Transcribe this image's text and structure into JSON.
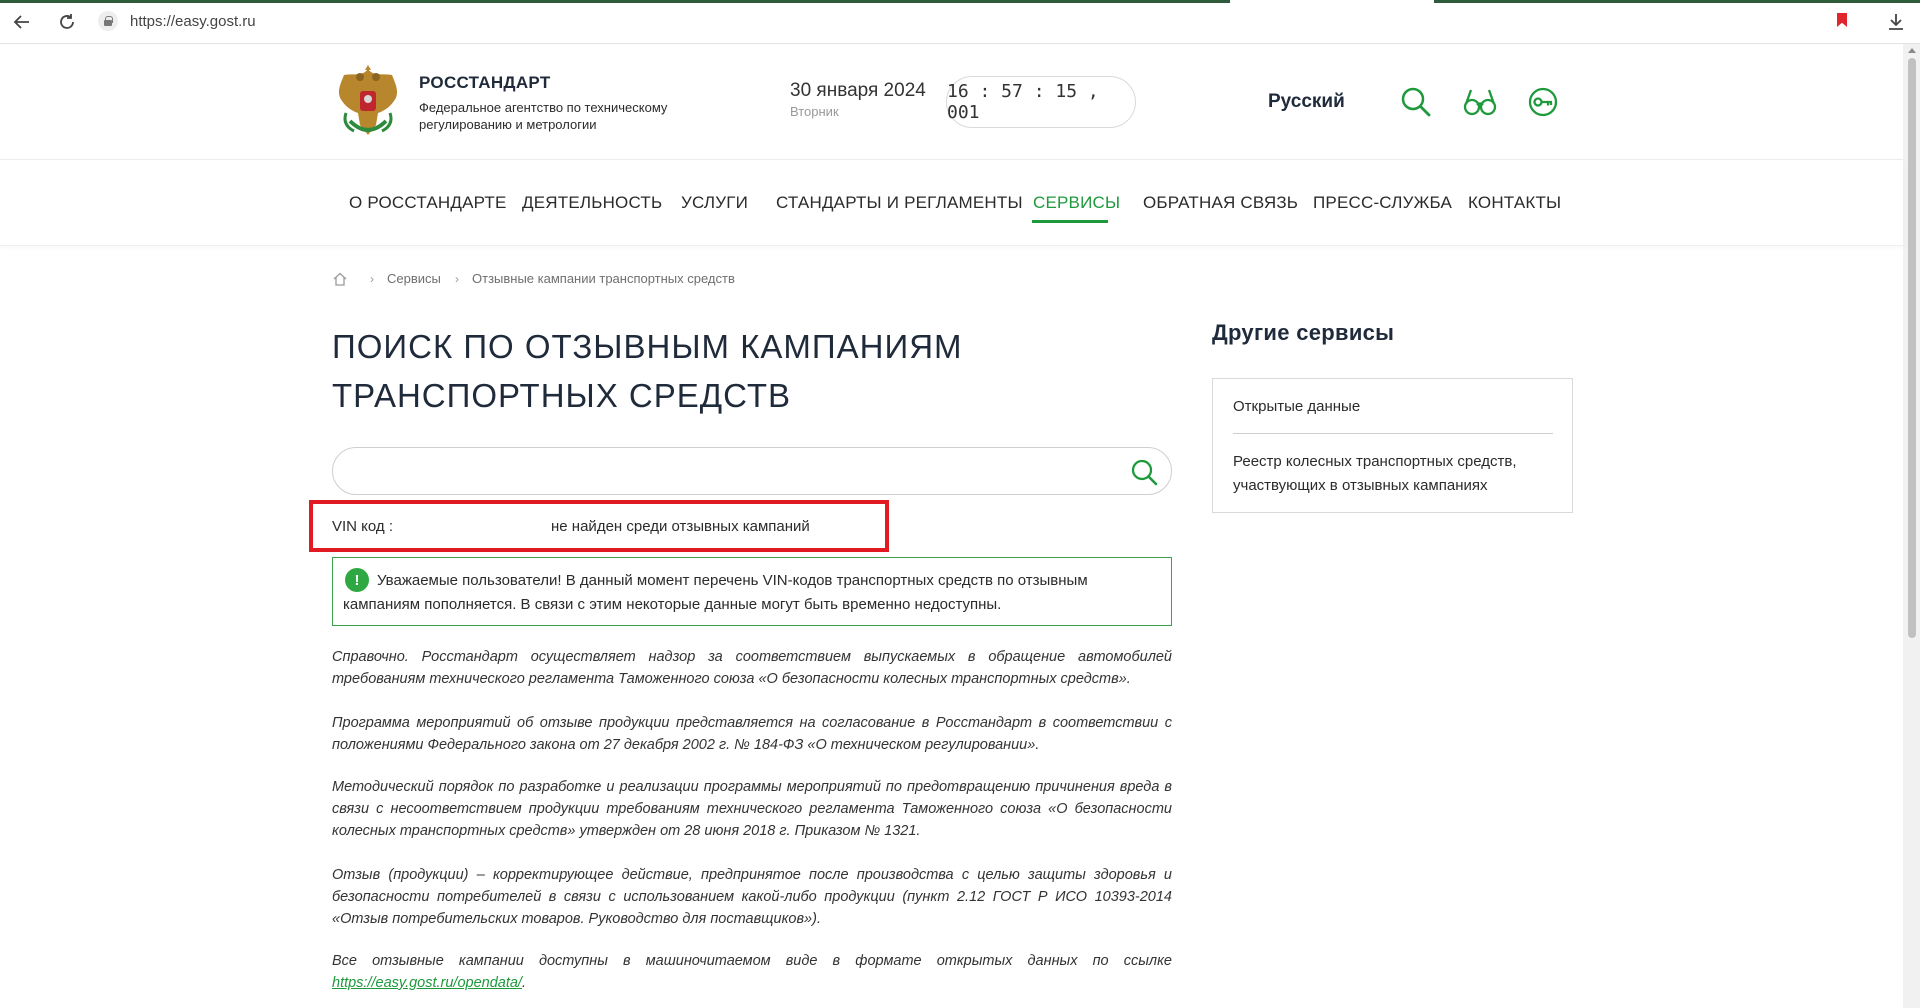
{
  "browser": {
    "url": "https://easy.gost.ru"
  },
  "header": {
    "org_name": "РОССТАНДАРТ",
    "org_description": "Федеральное агентство по техническому регулированию и метрологии",
    "date": "30 января 2024",
    "weekday": "Вторник",
    "clock": "16 : 57 : 15 , 001",
    "language": "Русский"
  },
  "nav": {
    "items": [
      {
        "label": "О РОССТАНДАРТЕ",
        "active": false
      },
      {
        "label": "ДЕЯТЕЛЬНОСТЬ",
        "active": false
      },
      {
        "label": "УСЛУГИ",
        "active": false
      },
      {
        "label": "СТАНДАРТЫ И РЕГЛАМЕНТЫ",
        "active": false
      },
      {
        "label": "СЕРВИСЫ",
        "active": true
      },
      {
        "label": "ОБРАТНАЯ СВЯЗЬ",
        "active": false
      },
      {
        "label": "ПРЕСС-СЛУЖБА",
        "active": false
      },
      {
        "label": "КОНТАКТЫ",
        "active": false
      }
    ]
  },
  "breadcrumb": {
    "items": [
      "Сервисы",
      "Отзывные кампании транспортных средств"
    ]
  },
  "main": {
    "title": "ПОИСК ПО ОТЗЫВНЫМ КАМПАНИЯМ ТРАНСПОРТНЫХ СРЕДСТВ",
    "search_value": "",
    "vin_prefix": "VIN код :",
    "vin_suffix": "не найден среди отзывных кампаний",
    "notice_badge": "!",
    "notice": "Уважаемые пользователи! В данный момент перечень VIN-кодов транспортных средств по отзывным кампаниям пополняется. В связи с этим некоторые данные могут быть временно недоступны.",
    "paragraphs": [
      "Справочно. Росстандарт осуществляет надзор за соответствием выпускаемых в обращение автомобилей требованиям технического регламента Таможенного союза «О безопасности колесных транспортных средств».",
      "Программа мероприятий об отзыве продукции представляется на согласование в Росстандарт в соответствии с положениями Федерального закона от 27 декабря 2002 г. № 184-ФЗ «О техническом регулировании».",
      "Методический порядок по разработке и реализации программы мероприятий по предотвращению причинения вреда в связи с несоответствием продукции требованиям технического регламента Таможенного союза «О безопасности колесных транспортных средств» утвержден от 28 июня 2018 г. Приказом № 1321.",
      "Отзыв (продукции) – корректирующее действие, предпринятое после производства с целью защиты здоровья и безопасности потребителей в связи с использованием какой-либо продукции (пункт 2.12 ГОСТ Р ИСО 10393-2014 «Отзыв потребительских товаров. Руководство для поставщиков»)."
    ],
    "last_paragraph_text": "Все отзывные кампании доступны в машиночитаемом виде в формате открытых данных по ссылке",
    "last_paragraph_link": "https://easy.gost.ru/opendata/",
    "last_paragraph_end": "."
  },
  "sidebar": {
    "title": "Другие сервисы",
    "links": [
      "Открытые данные",
      "Реестр колесных транспортных средств, участвующих в отзывных кампаниях"
    ]
  },
  "colors": {
    "accent_green": "#1e9a3c",
    "highlight_red": "#e01b24",
    "title_dark": "#1f2a3a"
  },
  "icons": [
    "back-arrow-icon",
    "reload-icon",
    "lock-icon",
    "bookmark-icon",
    "download-icon",
    "emblem-icon",
    "search-icon",
    "glasses-icon",
    "key-icon",
    "home-icon"
  ]
}
